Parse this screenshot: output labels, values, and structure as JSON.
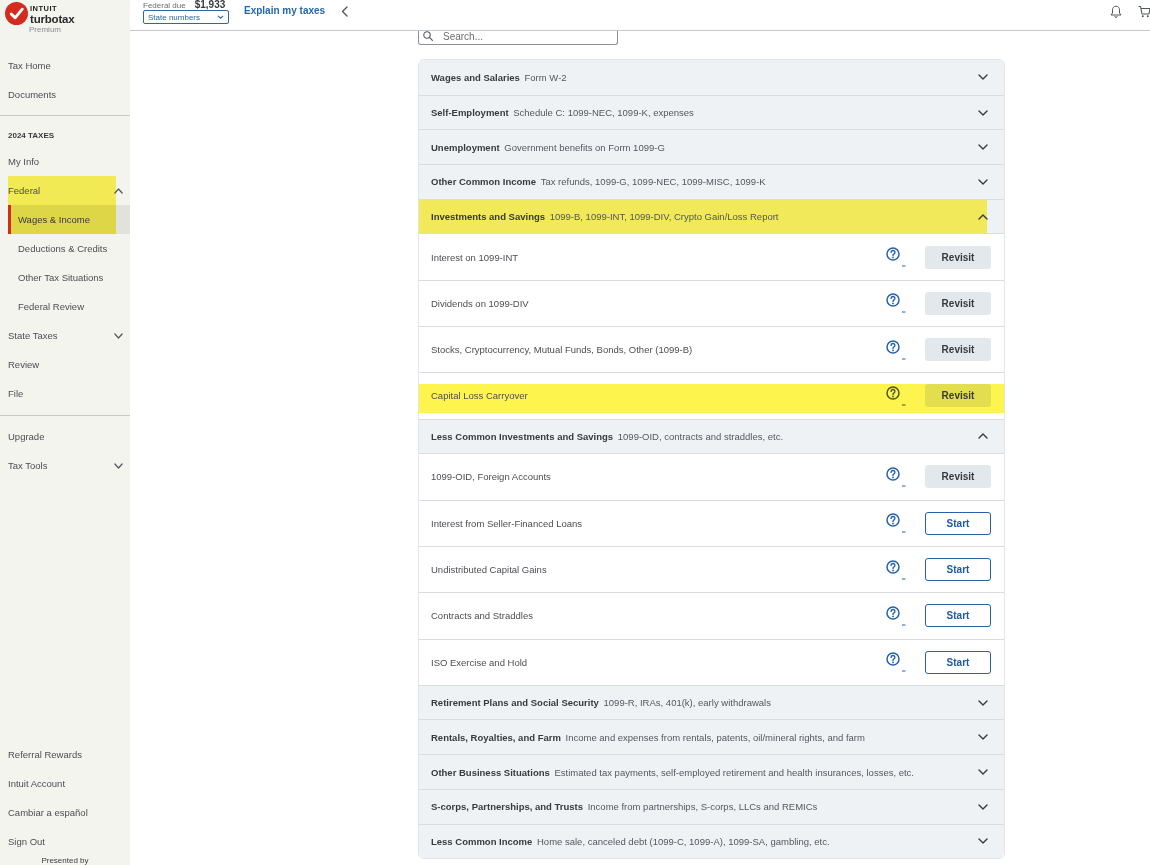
{
  "brand": {
    "company": "INTUIT",
    "product": "turbotax",
    "edition": "Premium"
  },
  "header": {
    "due_label": "Federal due",
    "due_amount": "$1,933",
    "state_select": {
      "value": "State numbers"
    },
    "explain_link": "Explain my taxes"
  },
  "sidebar": {
    "groups": [
      {
        "items": [
          {
            "label": "Tax Home",
            "selected": false,
            "highlighted": false
          },
          {
            "label": "Documents",
            "selected": false,
            "highlighted": false
          }
        ]
      },
      {
        "heading": "2024 TAXES",
        "items": [
          {
            "label": "My Info",
            "selected": false,
            "highlighted": false
          },
          {
            "label": "Federal",
            "selected": false,
            "highlighted": true,
            "expanded": true,
            "children": [
              {
                "label": "Wages & Income",
                "selected": true,
                "highlighted": true
              },
              {
                "label": "Deductions & Credits",
                "selected": false,
                "highlighted": false
              },
              {
                "label": "Other Tax Situations",
                "selected": false,
                "highlighted": false
              },
              {
                "label": "Federal Review",
                "selected": false,
                "highlighted": false
              }
            ]
          },
          {
            "label": "State Taxes",
            "selected": false,
            "highlighted": false,
            "expanded": false
          },
          {
            "label": "Review",
            "selected": false,
            "highlighted": false
          },
          {
            "label": "File",
            "selected": false,
            "highlighted": false
          }
        ]
      },
      {
        "items": [
          {
            "label": "Upgrade",
            "selected": false,
            "highlighted": false
          },
          {
            "label": "Tax Tools",
            "selected": false,
            "highlighted": false,
            "expanded": false
          }
        ]
      }
    ],
    "footer": {
      "items": [
        {
          "label": "Referral Rewards",
          "selected": false,
          "highlighted": false
        },
        {
          "label": "Intuit Account",
          "selected": false,
          "highlighted": false
        },
        {
          "label": "Cambiar a español",
          "selected": false,
          "highlighted": false
        },
        {
          "label": "Sign Out",
          "selected": false,
          "highlighted": false
        }
      ],
      "presented_by": "Presented by"
    }
  },
  "search": {
    "placeholder": "Search..."
  },
  "sections": [
    {
      "title": "Wages and Salaries",
      "description": "Form W-2",
      "expanded": false,
      "highlighted": false
    },
    {
      "title": "Self-Employment",
      "description": "Schedule C: 1099-NEC, 1099-K, expenses",
      "expanded": false,
      "highlighted": false
    },
    {
      "title": "Unemployment",
      "description": "Government benefits on Form 1099-G",
      "expanded": false,
      "highlighted": false
    },
    {
      "title": "Other Common Income",
      "description": "Tax refunds, 1099-G, 1099-NEC, 1099-MISC, 1099-K",
      "expanded": false,
      "highlighted": false
    },
    {
      "title": "Investments and Savings",
      "description": "1099-B, 1099-INT, 1099-DIV, Crypto Gain/Loss Report",
      "expanded": true,
      "highlighted": true,
      "rows": [
        {
          "label": "Interest on 1099-INT",
          "highlighted": false,
          "button": {
            "label": "Revisit",
            "kind": "revisit"
          }
        },
        {
          "label": "Dividends on 1099-DIV",
          "highlighted": false,
          "button": {
            "label": "Revisit",
            "kind": "revisit"
          }
        },
        {
          "label": "Stocks, Cryptocurrency, Mutual Funds, Bonds, Other (1099-B)",
          "highlighted": false,
          "button": {
            "label": "Revisit",
            "kind": "revisit"
          }
        },
        {
          "label": "Capital Loss Carryover",
          "highlighted": true,
          "button": {
            "label": "Revisit",
            "kind": "revisit"
          }
        }
      ]
    },
    {
      "title": "Less Common Investments and Savings",
      "description": "1099-OID, contracts and straddles, etc.",
      "expanded": true,
      "highlighted": false,
      "rows": [
        {
          "label": "1099-OID, Foreign Accounts",
          "highlighted": false,
          "button": {
            "label": "Revisit",
            "kind": "revisit"
          }
        },
        {
          "label": "Interest from Seller-Financed Loans",
          "highlighted": false,
          "button": {
            "label": "Start",
            "kind": "start"
          }
        },
        {
          "label": "Undistributed Capital Gains",
          "highlighted": false,
          "button": {
            "label": "Start",
            "kind": "start"
          }
        },
        {
          "label": "Contracts and Straddles",
          "highlighted": false,
          "button": {
            "label": "Start",
            "kind": "start"
          }
        },
        {
          "label": "ISO Exercise and Hold",
          "highlighted": false,
          "button": {
            "label": "Start",
            "kind": "start"
          }
        }
      ]
    },
    {
      "title": "Retirement Plans and Social Security",
      "description": "1099-R, IRAs, 401(k), early withdrawals",
      "expanded": false,
      "highlighted": false
    },
    {
      "title": "Rentals, Royalties, and Farm",
      "description": "Income and expenses from rentals, patents, oil/mineral rights, and farm",
      "expanded": false,
      "highlighted": false
    },
    {
      "title": "Other Business Situations",
      "description": "Estimated tax payments, self-employed retirement and health insurances, losses, etc.",
      "expanded": false,
      "highlighted": false
    },
    {
      "title": "S-corps, Partnerships, and Trusts",
      "description": "Income from partnerships, S-corps, LLCs and REMICs",
      "expanded": false,
      "highlighted": false
    },
    {
      "title": "Less Common Income",
      "description": "Home sale, canceled debt (1099-C, 1099-A), 1099-SA, gambling, etc.",
      "expanded": false,
      "highlighted": false
    }
  ]
}
